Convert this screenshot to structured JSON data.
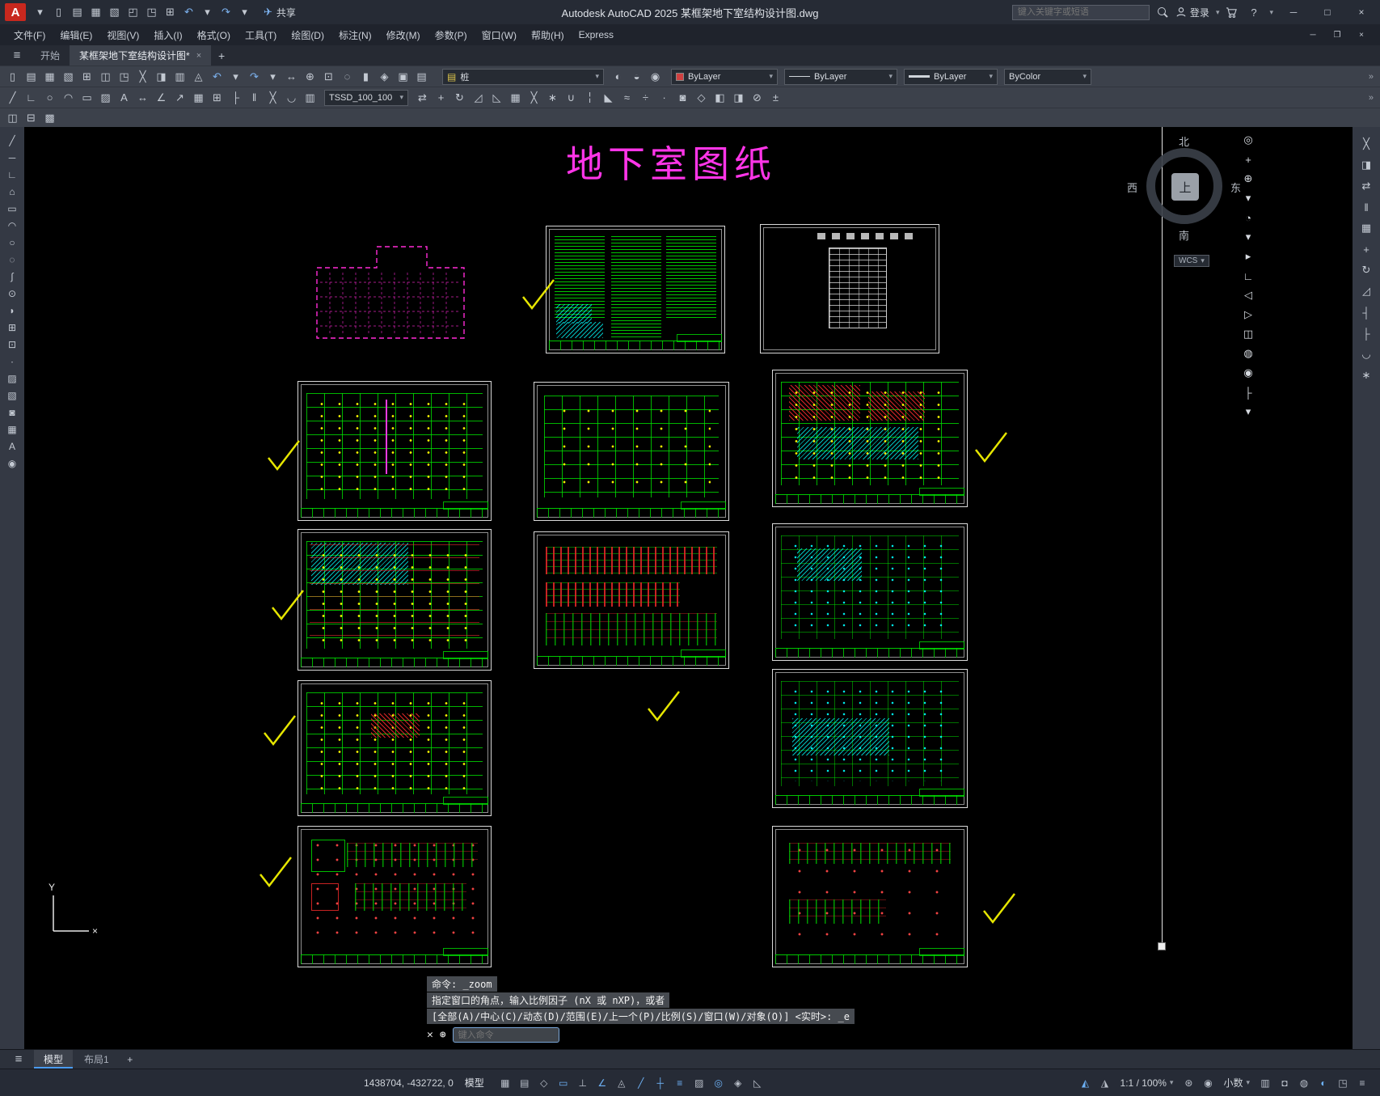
{
  "titlebar": {
    "logo_letter": "A",
    "qat_icons": [
      {
        "name": "qat-menu-icon",
        "glyph": "▾"
      },
      {
        "name": "new-icon",
        "glyph": "▯"
      },
      {
        "name": "open-icon",
        "glyph": "▤"
      },
      {
        "name": "save-icon",
        "glyph": "▦"
      },
      {
        "name": "save-as-icon",
        "glyph": "▧"
      },
      {
        "name": "open-from-web-icon",
        "glyph": "◰"
      },
      {
        "name": "save-to-web-icon",
        "glyph": "◳"
      },
      {
        "name": "plot-icon",
        "glyph": "⊞"
      },
      {
        "name": "undo-icon",
        "glyph": "↶",
        "color": "#7db3f0"
      },
      {
        "name": "undo-dropdown-icon",
        "glyph": "▾"
      },
      {
        "name": "redo-icon",
        "glyph": "↷",
        "color": "#7db3f0"
      },
      {
        "name": "redo-dropdown-icon",
        "glyph": "▾"
      }
    ],
    "share_label": "共享",
    "title": "Autodesk AutoCAD 2025   某框架地下室结构设计图.dwg",
    "search_placeholder": "键入关键字或短语",
    "signin_label": "登录",
    "help_label": "?"
  },
  "menubar": {
    "items": [
      "文件(F)",
      "编辑(E)",
      "视图(V)",
      "插入(I)",
      "格式(O)",
      "工具(T)",
      "绘图(D)",
      "标注(N)",
      "修改(M)",
      "参数(P)",
      "窗口(W)",
      "帮助(H)",
      "Express"
    ]
  },
  "doc_tabs": {
    "start": "开始",
    "active": "某框架地下室结构设计图*",
    "close": "×",
    "add": "+"
  },
  "toolbar1": {
    "icons": [
      {
        "name": "new-icon",
        "glyph": "▯"
      },
      {
        "name": "open-icon",
        "glyph": "▤"
      },
      {
        "name": "save-icon",
        "glyph": "▦"
      },
      {
        "name": "save-as-icon",
        "glyph": "▧"
      },
      {
        "name": "plot-icon",
        "glyph": "⊞"
      },
      {
        "name": "plot-preview-icon",
        "glyph": "◫"
      },
      {
        "name": "publish-icon",
        "glyph": "◳"
      },
      {
        "name": "cut-icon",
        "glyph": "╳"
      },
      {
        "name": "copy-clip-icon",
        "glyph": "◨"
      },
      {
        "name": "paste-icon",
        "glyph": "▥"
      },
      {
        "name": "match-properties-icon",
        "glyph": "◬"
      },
      {
        "name": "undo-icon",
        "glyph": "↶",
        "color": "#7db3f0"
      },
      {
        "name": "undo-dropdown-icon",
        "glyph": "▾"
      },
      {
        "name": "redo-icon",
        "glyph": "↷",
        "color": "#7db3f0"
      },
      {
        "name": "redo-dropdown-icon",
        "glyph": "▾"
      },
      {
        "name": "pan-icon",
        "glyph": "↔"
      },
      {
        "name": "zoom-realtime-icon",
        "glyph": "⊕"
      },
      {
        "name": "zoom-window-icon",
        "glyph": "⊡"
      },
      {
        "name": "zoom-previous-icon",
        "glyph": "◌"
      },
      {
        "name": "properties-icon",
        "glyph": "▮"
      },
      {
        "name": "designcenter-icon",
        "glyph": "◈"
      },
      {
        "name": "tool-palettes-icon",
        "glyph": "▣"
      },
      {
        "name": "layer-properties-icon",
        "glyph": "▤"
      }
    ],
    "layer_value": "桩",
    "post_icons": [
      {
        "name": "layer-off-icon",
        "glyph": "◐"
      },
      {
        "name": "layer-freeze-icon",
        "glyph": "◒"
      },
      {
        "name": "layer-lock-icon",
        "glyph": "◉"
      }
    ],
    "color_value": "ByLayer",
    "linetype_value": "ByLayer",
    "lineweight_value": "ByLayer",
    "plotstyle_value": "ByColor",
    "overflow": "»"
  },
  "toolbar2": {
    "left_icons": [
      {
        "name": "line-icon",
        "glyph": "╱"
      },
      {
        "name": "polyline-icon",
        "glyph": "∟"
      },
      {
        "name": "circle-icon",
        "glyph": "○"
      },
      {
        "name": "arc-icon",
        "glyph": "◠"
      },
      {
        "name": "rectangle-icon",
        "glyph": "▭"
      },
      {
        "name": "hatch-icon",
        "glyph": "▨"
      },
      {
        "name": "text-icon",
        "glyph": "A"
      },
      {
        "name": "linear-dimension-icon",
        "glyph": "↔"
      },
      {
        "name": "angular-dimension-icon",
        "glyph": "∠"
      },
      {
        "name": "leader-icon",
        "glyph": "↗"
      },
      {
        "name": "table-icon",
        "glyph": "▦"
      },
      {
        "name": "insert-block-icon",
        "glyph": "⊞"
      },
      {
        "name": "measure-icon",
        "glyph": "├"
      },
      {
        "name": "offset-icon",
        "glyph": "‖"
      },
      {
        "name": "trim-icon",
        "glyph": "╳"
      },
      {
        "name": "fillet-icon",
        "glyph": "◡"
      },
      {
        "name": "layer-control-icon",
        "glyph": "▥"
      }
    ],
    "tssd_value": "TSSD_100_100",
    "right_icons": [
      {
        "name": "mirror-icon",
        "glyph": "⇄"
      },
      {
        "name": "move-icon",
        "glyph": "+"
      },
      {
        "name": "rotate-icon",
        "glyph": "↻"
      },
      {
        "name": "scale-icon",
        "glyph": "◿"
      },
      {
        "name": "stretch-icon",
        "glyph": "◺"
      },
      {
        "name": "array-icon",
        "glyph": "▦"
      },
      {
        "name": "erase-icon",
        "glyph": "╳"
      },
      {
        "name": "explode-icon",
        "glyph": "∗"
      },
      {
        "name": "join-icon",
        "glyph": "∪"
      },
      {
        "name": "break-icon",
        "glyph": "╎"
      },
      {
        "name": "chamfer-icon",
        "glyph": "◣"
      },
      {
        "name": "align-icon",
        "glyph": "≈"
      },
      {
        "name": "divide-icon",
        "glyph": "÷"
      },
      {
        "name": "point-icon",
        "glyph": "∙"
      },
      {
        "name": "region-icon",
        "glyph": "◙"
      },
      {
        "name": "boundary-icon",
        "glyph": "◇"
      },
      {
        "name": "group-icon",
        "glyph": "◧"
      },
      {
        "name": "ungroup-icon",
        "glyph": "◨"
      },
      {
        "name": "purge-icon",
        "glyph": "⊘"
      },
      {
        "name": "quick-calc-icon",
        "glyph": "±"
      }
    ],
    "overflow": "»"
  },
  "toolbar3": {
    "icons": [
      {
        "name": "layer-states-icon",
        "glyph": "◫"
      },
      {
        "name": "dwg-compare-icon",
        "glyph": "⊟"
      },
      {
        "name": "xref-fade-icon",
        "glyph": "▩"
      }
    ]
  },
  "left_toolbar": {
    "icons": [
      {
        "name": "line-icon",
        "glyph": "╱"
      },
      {
        "name": "construction-line-icon",
        "glyph": "─"
      },
      {
        "name": "polyline-icon",
        "glyph": "∟"
      },
      {
        "name": "polygon-icon",
        "glyph": "⌂"
      },
      {
        "name": "rectangle-icon",
        "glyph": "▭"
      },
      {
        "name": "arc-icon",
        "glyph": "◠"
      },
      {
        "name": "circle-icon",
        "glyph": "○"
      },
      {
        "name": "revision-cloud-icon",
        "glyph": "◌"
      },
      {
        "name": "spline-icon",
        "glyph": "∫"
      },
      {
        "name": "ellipse-icon",
        "glyph": "⊙"
      },
      {
        "name": "ellipse-arc-icon",
        "glyph": "◗"
      },
      {
        "name": "insert-block-icon",
        "glyph": "⊞"
      },
      {
        "name": "make-block-icon",
        "glyph": "⊡"
      },
      {
        "name": "point-icon",
        "glyph": "∙"
      },
      {
        "name": "hatch-icon",
        "glyph": "▨"
      },
      {
        "name": "gradient-icon",
        "glyph": "▧"
      },
      {
        "name": "region-icon",
        "glyph": "◙"
      },
      {
        "name": "table-icon",
        "glyph": "▦"
      },
      {
        "name": "multiline-text-icon",
        "glyph": "A"
      },
      {
        "name": "point-style-icon",
        "glyph": "◉"
      }
    ]
  },
  "nav_column": {
    "icons": [
      {
        "name": "nav-wheel-icon",
        "glyph": "◎"
      },
      {
        "name": "pan-icon",
        "glyph": "+"
      },
      {
        "name": "zoom-extents-icon",
        "glyph": "⊕"
      },
      {
        "name": "zoom-dropdown-icon",
        "glyph": "▾"
      },
      {
        "name": "orbit-icon",
        "glyph": "◔"
      },
      {
        "name": "orbit-dropdown-icon",
        "glyph": "▾"
      },
      {
        "name": "show-motion-icon",
        "glyph": "▸"
      },
      {
        "name": "ucs-tool-icon",
        "glyph": "∟"
      },
      {
        "name": "view-back-icon",
        "glyph": "◁"
      },
      {
        "name": "view-forward-icon",
        "glyph": "▷"
      },
      {
        "name": "section-icon",
        "glyph": "◫"
      },
      {
        "name": "steering-icon",
        "glyph": "◍"
      },
      {
        "name": "camera-icon",
        "glyph": "◉"
      },
      {
        "name": "measure-icon",
        "glyph": "├"
      },
      {
        "name": "nav-menu-icon",
        "glyph": "▾"
      }
    ]
  },
  "right_dock": {
    "icons": [
      {
        "name": "erase-icon",
        "glyph": "╳"
      },
      {
        "name": "copy-icon",
        "glyph": "◨"
      },
      {
        "name": "mirror-icon",
        "glyph": "⇄"
      },
      {
        "name": "offset-icon",
        "glyph": "‖"
      },
      {
        "name": "array-icon",
        "glyph": "▦"
      },
      {
        "name": "move-icon",
        "glyph": "+"
      },
      {
        "name": "rotate-icon",
        "glyph": "↻"
      },
      {
        "name": "scale-icon",
        "glyph": "◿"
      },
      {
        "name": "trim-icon",
        "glyph": "┤"
      },
      {
        "name": "extend-icon",
        "glyph": "├"
      },
      {
        "name": "fillet-icon",
        "glyph": "◡"
      },
      {
        "name": "explode-icon",
        "glyph": "∗"
      }
    ]
  },
  "canvas": {
    "sheet_title": "地下室图纸",
    "compass": {
      "north": "北",
      "south": "南",
      "west": "西",
      "east": "东",
      "center": "上",
      "wcs_label": "WCS"
    },
    "ucs": {
      "x_label": "×",
      "y_label": "Y"
    }
  },
  "command": {
    "line1": "命令:  _zoom",
    "line2": "指定窗口的角点，输入比例因子 (nX 或 nXP)，或者",
    "line3": "[全部(A)/中心(C)/动态(D)/范围(E)/上一个(P)/比例(S)/窗口(W)/对象(O)] <实时>:  _e",
    "close_glyph": "✕",
    "wrench_glyph": "⊛",
    "placeholder": "键入命令"
  },
  "layout_tabs": {
    "menu_glyph": "≡",
    "model": "模型",
    "layout1": "布局1",
    "add": "+"
  },
  "statusbar": {
    "coords": "1438704, -432722, 0",
    "model_label": "模型",
    "icons_a": [
      {
        "name": "grid-icon",
        "glyph": "▦"
      },
      {
        "name": "snap-mode-icon",
        "glyph": "▤"
      },
      {
        "name": "infer-constraints-icon",
        "glyph": "◇"
      },
      {
        "name": "dynamic-input-icon",
        "glyph": "▭",
        "active": true
      },
      {
        "name": "ortho-mode-icon",
        "glyph": "⊥"
      },
      {
        "name": "polar-tracking-icon",
        "glyph": "∠",
        "active": true
      },
      {
        "name": "isometric-drafting-icon",
        "glyph": "◬"
      },
      {
        "name": "object-snap-tracking-icon",
        "glyph": "╱",
        "active": true
      },
      {
        "name": "object-snap-icon",
        "glyph": "┼",
        "active": true
      },
      {
        "name": "lineweight-display-icon",
        "glyph": "≡",
        "active": true
      },
      {
        "name": "transparency-icon",
        "glyph": "▨"
      },
      {
        "name": "selection-cycling-icon",
        "glyph": "◎",
        "active": true
      },
      {
        "name": "3d-object-snap-icon",
        "glyph": "◈"
      },
      {
        "name": "dynamic-ucs-icon",
        "glyph": "◺"
      }
    ],
    "icons_b": [
      {
        "name": "annotation-visibility-icon",
        "glyph": "◭",
        "active": true
      },
      {
        "name": "annotation-autoscale-icon",
        "glyph": "◮"
      }
    ],
    "scale_label": "1:1 / 100%",
    "icons_c": [
      {
        "name": "workspace-switching-icon",
        "glyph": "⊛"
      },
      {
        "name": "annotation-monitor-icon",
        "glyph": "◉"
      }
    ],
    "units_label": "小数",
    "icons_d": [
      {
        "name": "quick-properties-icon",
        "glyph": "▥"
      },
      {
        "name": "lock-ui-icon",
        "glyph": "◘"
      },
      {
        "name": "isolate-objects-icon",
        "glyph": "◍"
      },
      {
        "name": "graphics-performance-icon",
        "glyph": "◐",
        "active": true
      },
      {
        "name": "clean-screen-icon",
        "glyph": "◳"
      },
      {
        "name": "customization-icon",
        "glyph": "≡"
      }
    ]
  }
}
